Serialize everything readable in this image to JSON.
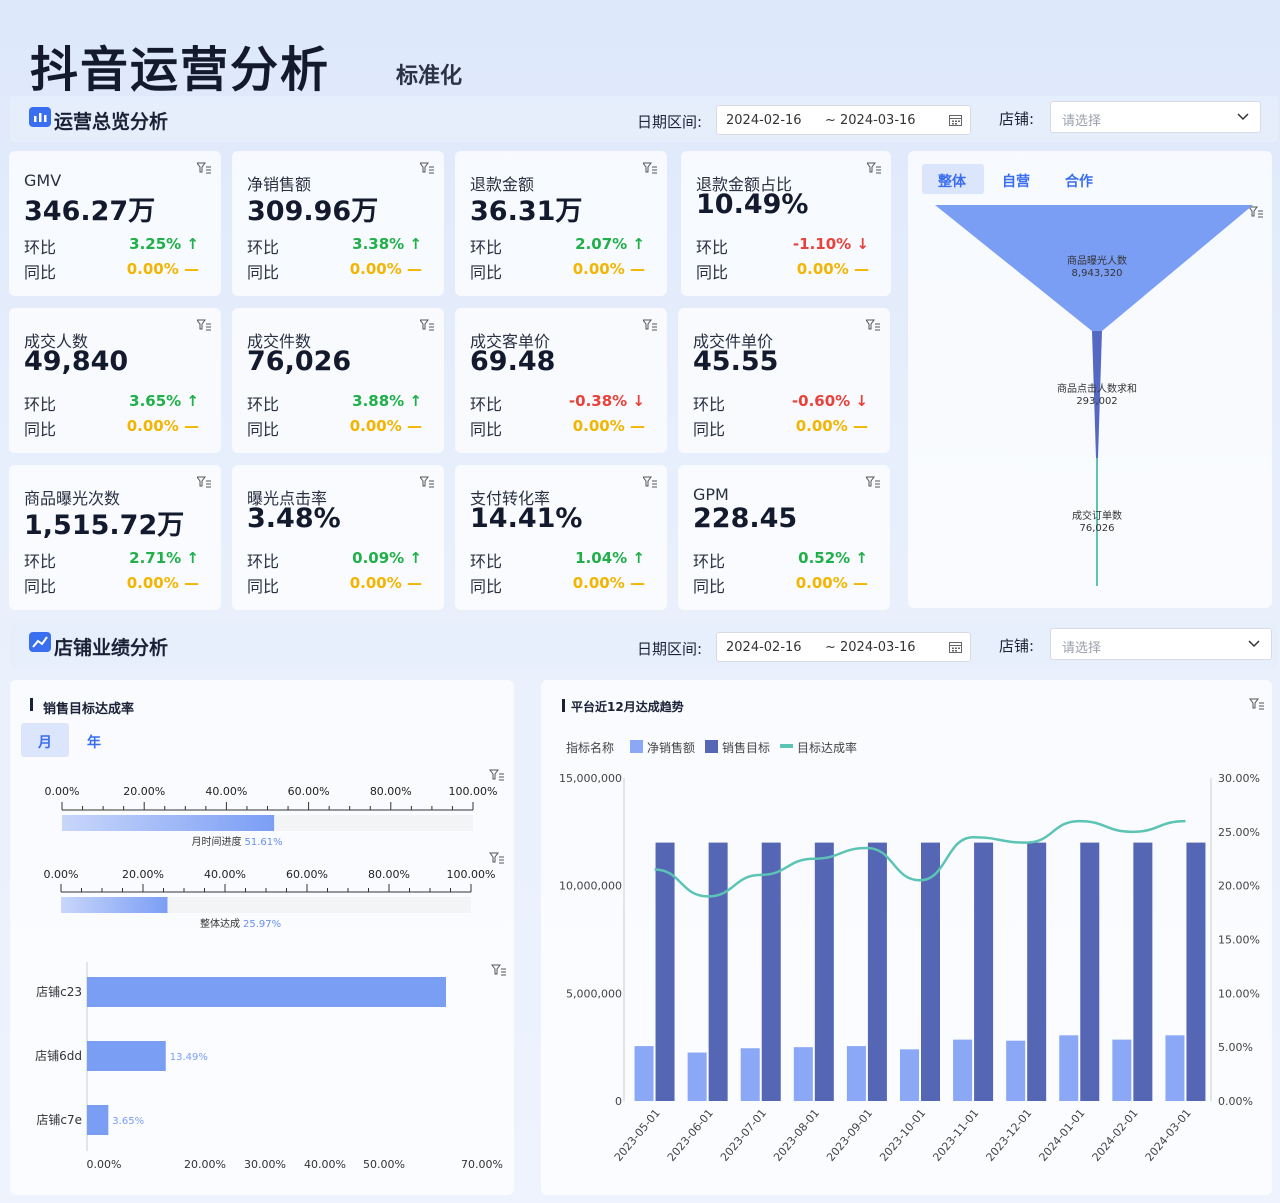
{
  "header": {
    "title": "抖音运营分析",
    "subtitle": "标准化"
  },
  "overview": {
    "section_title": "运营总览分析",
    "date_label": "日期区间:",
    "date_start": "2024-02-16",
    "date_sep": "~",
    "date_end": "2024-03-16",
    "store_label": "店铺:",
    "store_placeholder": "请选择"
  },
  "kpi_labels": {
    "mom": "环比",
    "yoy": "同比"
  },
  "kpis": [
    {
      "name": "GMV",
      "value": "346.27万",
      "mom": "3.25%",
      "mom_dir": "up",
      "yoy": "0.00%"
    },
    {
      "name": "净销售额",
      "value": "309.96万",
      "mom": "3.38%",
      "mom_dir": "up",
      "yoy": "0.00%"
    },
    {
      "name": "退款金额",
      "value": "36.31万",
      "mom": "2.07%",
      "mom_dir": "up",
      "yoy": "0.00%"
    },
    {
      "name": "退款金额占比",
      "value": "10.49%",
      "mom": "-1.10%",
      "mom_dir": "down",
      "yoy": "0.00%"
    },
    {
      "name": "成交人数",
      "value": "49,840",
      "mom": "3.65%",
      "mom_dir": "up",
      "yoy": "0.00%"
    },
    {
      "name": "成交件数",
      "value": "76,026",
      "mom": "3.88%",
      "mom_dir": "up",
      "yoy": "0.00%"
    },
    {
      "name": "成交客单价",
      "value": "69.48",
      "mom": "-0.38%",
      "mom_dir": "down",
      "yoy": "0.00%"
    },
    {
      "name": "成交件单价",
      "value": "45.55",
      "mom": "-0.60%",
      "mom_dir": "down",
      "yoy": "0.00%"
    },
    {
      "name": "商品曝光次数",
      "value": "1,515.72万",
      "mom": "2.71%",
      "mom_dir": "up",
      "yoy": "0.00%"
    },
    {
      "name": "曝光点击率",
      "value": "3.48%",
      "mom": "0.09%",
      "mom_dir": "up",
      "yoy": "0.00%"
    },
    {
      "name": "支付转化率",
      "value": "14.41%",
      "mom": "1.04%",
      "mom_dir": "up",
      "yoy": "0.00%"
    },
    {
      "name": "GPM",
      "value": "228.45",
      "mom": "0.52%",
      "mom_dir": "up",
      "yoy": "0.00%"
    }
  ],
  "funnel": {
    "tabs": [
      "整体",
      "自营",
      "合作"
    ],
    "active_tab": 0,
    "stages": [
      {
        "label": "商品曝光人数",
        "value": "8,943,320"
      },
      {
        "label": "商品点击人数求和",
        "value": "293,002"
      },
      {
        "label": "成交订单数",
        "value": "76,026"
      }
    ],
    "color": "#7b9ef5"
  },
  "stores": {
    "section_title": "店铺业绩分析",
    "date_label": "日期区间:",
    "date_start": "2024-02-16",
    "date_sep": "~",
    "date_end": "2024-03-16",
    "store_label": "店铺:",
    "store_placeholder": "请选择"
  },
  "target_panel": {
    "title": "销售目标达成率",
    "tabs": [
      "月",
      "年"
    ],
    "active_tab": 0,
    "gauges": [
      {
        "ticks": [
          "0.00%",
          "20.00%",
          "40.00%",
          "60.00%",
          "80.00%",
          "100.00%"
        ],
        "label": "月时间进度",
        "value_text": "51.61%",
        "value": 51.61
      },
      {
        "ticks": [
          "0.00%",
          "20.00%",
          "40.00%",
          "60.00%",
          "80.00%",
          "100.00%"
        ],
        "label": "整体达成",
        "value_text": "25.97%",
        "value": 25.97
      }
    ]
  },
  "chart_data": [
    {
      "type": "bar",
      "orientation": "horizontal",
      "categories": [
        "店铺c23",
        "店铺6dd",
        "店铺c7e"
      ],
      "values": [
        61.5,
        13.49,
        3.65
      ],
      "data_labels": [
        "",
        "13.49%",
        "3.65%"
      ],
      "x_ticks": [
        "0.00%",
        "20.00%",
        "30.00%",
        "40.00%",
        "50.00%",
        "70.00%"
      ],
      "xlim": [
        0,
        70
      ]
    },
    {
      "type": "bar",
      "title": "平台近12月达成趋势",
      "legend_title": "指标名称",
      "categories": [
        "2023-05-01",
        "2023-06-01",
        "2023-07-01",
        "2023-08-01",
        "2023-09-01",
        "2023-10-01",
        "2023-11-01",
        "2023-12-01",
        "2024-01-01",
        "2024-02-01",
        "2024-03-01"
      ],
      "series": [
        {
          "name": "净销售额",
          "type": "bar",
          "axis": "left",
          "color": "#8aa8f5",
          "values": [
            2550000,
            2250000,
            2450000,
            2500000,
            2550000,
            2400000,
            2850000,
            2800000,
            3050000,
            2850000,
            3050000
          ]
        },
        {
          "name": "销售目标",
          "type": "bar",
          "axis": "left",
          "color": "#5566b5",
          "values": [
            12000000,
            12000000,
            12000000,
            12000000,
            12000000,
            12000000,
            12000000,
            12000000,
            12000000,
            12000000,
            12000000
          ]
        },
        {
          "name": "目标达成率",
          "type": "line",
          "axis": "right",
          "color": "#5bc4b5",
          "values": [
            21.5,
            19,
            21,
            22.5,
            23.5,
            20.5,
            24.5,
            24,
            26,
            25,
            26
          ]
        }
      ],
      "y_left_ticks": [
        "0",
        "5,000,000",
        "10,000,000",
        "15,000,000"
      ],
      "ylim_left": [
        0,
        15000000
      ],
      "y_right_ticks": [
        "0.00%",
        "5.00%",
        "10.00%",
        "15.00%",
        "20.00%",
        "25.00%",
        "30.00%"
      ],
      "ylim_right": [
        0,
        30
      ],
      "legend_position": "top-left"
    }
  ]
}
